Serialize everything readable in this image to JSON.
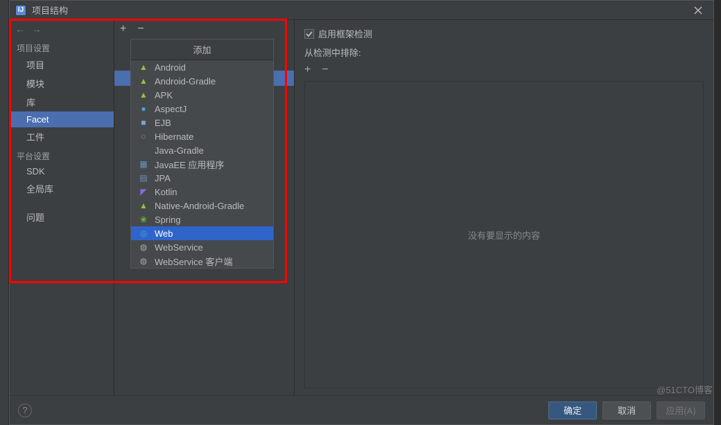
{
  "titlebar": {
    "title": "项目结构"
  },
  "sidebar": {
    "sections": [
      {
        "label": "项目设置",
        "items": [
          "项目",
          "模块",
          "库",
          "Facet",
          "工件"
        ]
      },
      {
        "label": "平台设置",
        "items": [
          "SDK",
          "全局库"
        ]
      },
      {
        "label": "",
        "items": [
          "问题"
        ]
      }
    ],
    "selected": "Facet"
  },
  "middle": {
    "addIcon": "+",
    "removeIcon": "−"
  },
  "popup": {
    "title": "添加",
    "items": [
      {
        "label": "Android",
        "icon": "android"
      },
      {
        "label": "Android-Gradle",
        "icon": "android"
      },
      {
        "label": "APK",
        "icon": "android"
      },
      {
        "label": "AspectJ",
        "icon": "aspectj"
      },
      {
        "label": "EJB",
        "icon": "ejb"
      },
      {
        "label": "Hibernate",
        "icon": "hibernate"
      },
      {
        "label": "Java-Gradle",
        "icon": "none"
      },
      {
        "label": "JavaEE 应用程序",
        "icon": "javaee"
      },
      {
        "label": "JPA",
        "icon": "jpa"
      },
      {
        "label": "Kotlin",
        "icon": "kotlin"
      },
      {
        "label": "Native-Android-Gradle",
        "icon": "android"
      },
      {
        "label": "Spring",
        "icon": "spring"
      },
      {
        "label": "Web",
        "icon": "web"
      },
      {
        "label": "WebService",
        "icon": "webservices"
      },
      {
        "label": "WebService 客户端",
        "icon": "webservices"
      }
    ],
    "selected": "Web"
  },
  "right": {
    "enableDetection": "启用框架检测",
    "excludeLabel": "从检测中排除:",
    "empty": "没有要显示的内容"
  },
  "footer": {
    "ok": "确定",
    "cancel": "取消",
    "apply": "应用(A)"
  },
  "watermark": "@51CTO博客",
  "icons": {
    "android": {
      "char": "▲",
      "color": "#97c23c"
    },
    "aspectj": {
      "char": "●",
      "color": "#4aa3df"
    },
    "ejb": {
      "char": "■",
      "color": "#7aa5d6"
    },
    "hibernate": {
      "char": "◌",
      "color": "#c8b28e"
    },
    "none": {
      "char": "",
      "color": "#888"
    },
    "javaee": {
      "char": "▦",
      "color": "#6897bb"
    },
    "jpa": {
      "char": "▤",
      "color": "#6897bb"
    },
    "kotlin": {
      "char": "◤",
      "color": "#806ee3"
    },
    "spring": {
      "char": "❀",
      "color": "#6db33f"
    },
    "web": {
      "char": "◎",
      "color": "#4aa3df"
    },
    "webservices": {
      "char": "◍",
      "color": "#a8a8a8"
    }
  }
}
